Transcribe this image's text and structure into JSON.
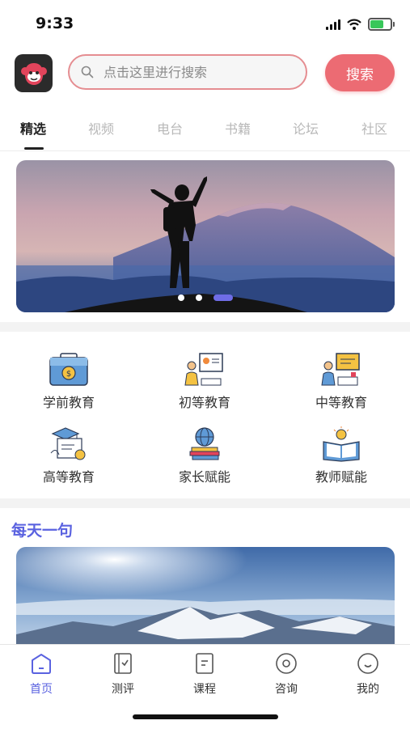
{
  "status_bar": {
    "time": "9:33"
  },
  "header": {
    "search_placeholder": "点击这里进行搜索",
    "search_button": "搜索"
  },
  "tabs": [
    {
      "label": "精选",
      "active": true
    },
    {
      "label": "视频"
    },
    {
      "label": "电台"
    },
    {
      "label": "书籍"
    },
    {
      "label": "论坛"
    },
    {
      "label": "社区"
    }
  ],
  "banner": {
    "pages": 3,
    "active_page": 3
  },
  "categories": [
    {
      "label": "学前教育",
      "icon": "briefcase-coin-icon"
    },
    {
      "label": "初等教育",
      "icon": "teacher-board-icon"
    },
    {
      "label": "中等教育",
      "icon": "teacher-sign-icon"
    },
    {
      "label": "高等教育",
      "icon": "graduation-diploma-icon"
    },
    {
      "label": "家长赋能",
      "icon": "globe-books-icon"
    },
    {
      "label": "教师赋能",
      "icon": "open-book-bulb-icon"
    }
  ],
  "daily": {
    "title": "每天一句"
  },
  "bottom_nav": [
    {
      "label": "首页",
      "icon": "home-icon",
      "active": true
    },
    {
      "label": "测评",
      "icon": "assessment-icon"
    },
    {
      "label": "课程",
      "icon": "course-icon"
    },
    {
      "label": "咨询",
      "icon": "consult-icon"
    },
    {
      "label": "我的",
      "icon": "profile-icon"
    }
  ],
  "colors": {
    "accent": "#ec6b73",
    "brand": "#5a62e0"
  }
}
